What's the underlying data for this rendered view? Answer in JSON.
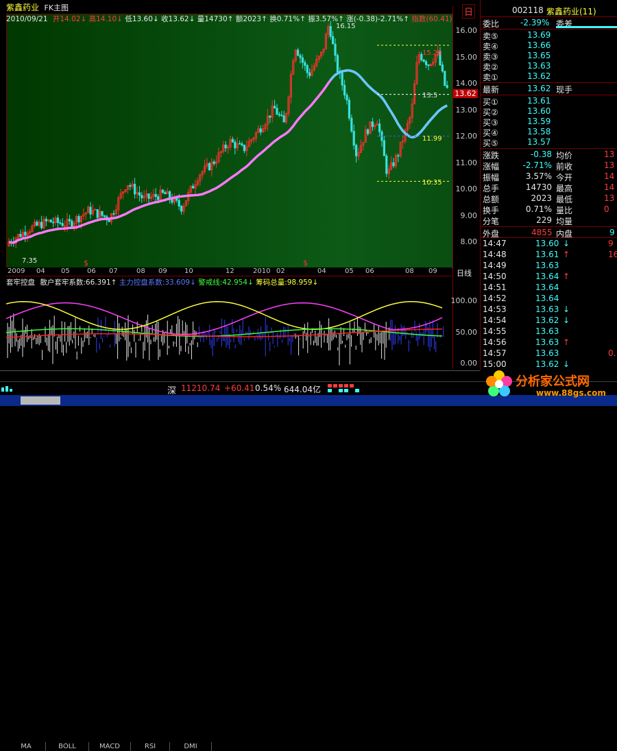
{
  "title": "紫鑫药业",
  "chart_type_label": "FK主图",
  "info": {
    "date": "2010/09/21",
    "open_label": "开",
    "open": "14.02",
    "high_label": "高",
    "high": "14.10",
    "low_label": "低",
    "low": "13.60",
    "close_label": "收",
    "close": "13.62",
    "vol_label": "量",
    "vol": "14730",
    "amt_label": "额",
    "amt": "2023",
    "turn_label": "换",
    "turn": "0.71%",
    "amp_label": "振",
    "amp": "3.57%",
    "chg_label": "涨",
    "chg": "(-0.38)-2.71%",
    "index_label": "指数",
    "index": "(60.41)"
  },
  "right_top_tag": "日",
  "main_annotations": {
    "peak": "16.15",
    "top_right": "15.28",
    "cur_mark": "13.5",
    "mid": "11.99",
    "low_right": "10.35",
    "min_left": "7.35",
    "current_price_tag": "13.62"
  },
  "y_ticks": [
    "16.00",
    "15.00",
    "14.00",
    "13.00",
    "12.00",
    "11.00",
    "10.00",
    "9.00",
    "8.00"
  ],
  "x_ticks": [
    "2009",
    "04",
    "05",
    "06",
    "07",
    "08",
    "09",
    "10",
    "12",
    "2010",
    "02",
    "04",
    "05",
    "06",
    "08",
    "09"
  ],
  "x_period_label": "日线",
  "sub": {
    "name": "套牢控盘",
    "l1_label": "散户套牢系数:",
    "l1": "66.391",
    "l2_label": "主力控盘系数:",
    "l2": "33.609",
    "l3_label": "警戒线:",
    "l3": "42.954",
    "l4_label": "筹码总量:",
    "l4": "98.959",
    "ticks": [
      "100.00",
      "50.00",
      "0.00"
    ]
  },
  "tabs": [
    "MA",
    "BOLL",
    "MACD",
    "RSI",
    "DMI"
  ],
  "quote": {
    "code": "002118",
    "name": "紫鑫药业(11)",
    "weibi_label": "委比",
    "weibi": "-2.39%",
    "weicha_label": "委差",
    "weicha": "",
    "asks": [
      {
        "label": "卖⑤",
        "price": "13.69"
      },
      {
        "label": "卖④",
        "price": "13.66"
      },
      {
        "label": "卖③",
        "price": "13.65"
      },
      {
        "label": "卖②",
        "price": "13.63"
      },
      {
        "label": "卖①",
        "price": "13.62"
      }
    ],
    "last_label": "最新",
    "last": "13.62",
    "xianshou_label": "现手",
    "bids": [
      {
        "label": "买①",
        "price": "13.61"
      },
      {
        "label": "买②",
        "price": "13.60"
      },
      {
        "label": "买③",
        "price": "13.59"
      },
      {
        "label": "买④",
        "price": "13.58"
      },
      {
        "label": "买⑤",
        "price": "13.57"
      }
    ],
    "stats": [
      {
        "l": "涨跌",
        "v": "-0.38",
        "l2": "均价",
        "v2": "13"
      },
      {
        "l": "涨幅",
        "v": "-2.71%",
        "l2": "前收",
        "v2": "13"
      },
      {
        "l": "振幅",
        "v": "3.57%",
        "l2": "今开",
        "v2": "14"
      },
      {
        "l": "总手",
        "v": "14730",
        "l2": "最高",
        "v2": "14"
      },
      {
        "l": "总额",
        "v": "2023",
        "l2": "最低",
        "v2": "13"
      },
      {
        "l": "换手",
        "v": "0.71%",
        "l2": "量比",
        "v2": "0"
      },
      {
        "l": "分笔",
        "v": "229",
        "l2": "均量",
        "v2": ""
      }
    ],
    "outer_label": "外盘",
    "outer": "4855",
    "inner_label": "内盘",
    "inner": "9"
  },
  "ticks_list": [
    {
      "t": "14:47",
      "p": "13.60",
      "d": "↓",
      "v": "9"
    },
    {
      "t": "14:48",
      "p": "13.61",
      "d": "↑",
      "v": "16"
    },
    {
      "t": "14:49",
      "p": "13.63",
      "d": "",
      "v": ""
    },
    {
      "t": "14:50",
      "p": "13.64",
      "d": "↑",
      "v": ""
    },
    {
      "t": "14:51",
      "p": "13.64",
      "d": "",
      "v": ""
    },
    {
      "t": "14:52",
      "p": "13.64",
      "d": "",
      "v": ""
    },
    {
      "t": "14:53",
      "p": "13.63",
      "d": "↓",
      "v": ""
    },
    {
      "t": "14:54",
      "p": "13.62",
      "d": "↓",
      "v": ""
    },
    {
      "t": "14:55",
      "p": "13.63",
      "d": "",
      "v": ""
    },
    {
      "t": "14:56",
      "p": "13.63",
      "d": "↑",
      "v": ""
    },
    {
      "t": "14:57",
      "p": "13.63",
      "d": "",
      "v": "0."
    },
    {
      "t": "15:00",
      "p": "13.62",
      "d": "↓",
      "v": ""
    }
  ],
  "status": {
    "market": "深",
    "index": "11210.74",
    "change": "+60.41",
    "pct": "0.54%",
    "amount": "644.04亿"
  },
  "watermark": {
    "brand": "分析家公式网",
    "url": "www.88gs.com"
  },
  "colors": {
    "up": "#ff3c3c",
    "down": "#3cffff",
    "panel_bg": "#0c5a16"
  }
}
